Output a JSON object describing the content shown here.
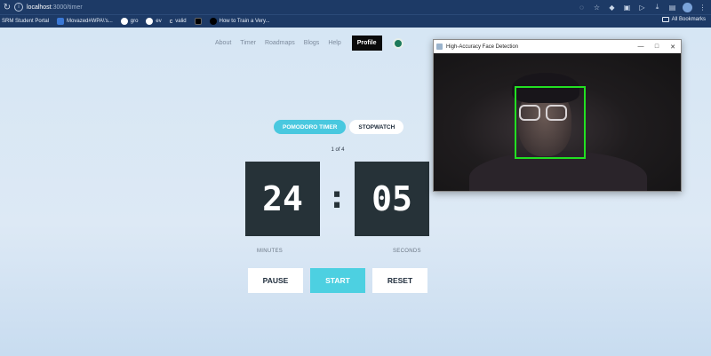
{
  "browser": {
    "url_host": "localhost",
    "url_path": ":3000/timer",
    "bookmarks": [
      {
        "label": "SRM Student Portal",
        "color": "#ffffff"
      },
      {
        "label": "Movazed#WPA\\'s...",
        "color": "#3a78d6"
      },
      {
        "label": "gro",
        "color": "#ffffff"
      },
      {
        "label": "ev",
        "color": "#ffffff"
      },
      {
        "label": "valid",
        "color": "#ffffff"
      },
      {
        "label": "",
        "color": "#000000"
      },
      {
        "label": "How to Train a Very...",
        "color": "#000000"
      }
    ],
    "all_bookmarks": "All Bookmarks"
  },
  "nav": {
    "items": [
      "About",
      "Timer",
      "Roadmaps",
      "Blogs",
      "Help"
    ],
    "profile": "Profile"
  },
  "timer": {
    "tabs": [
      "POMODORO TIMER",
      "STOPWATCH"
    ],
    "session": "1 of 4",
    "minutes": "24",
    "seconds": "05",
    "colon": ":",
    "minutes_label": "MINUTES",
    "seconds_label": "SECONDS",
    "buttons": {
      "pause": "PAUSE",
      "start": "START",
      "reset": "RESET"
    }
  },
  "camera_window": {
    "title": "High-Accuracy Face Detection",
    "detection_color": "#22e022"
  },
  "colors": {
    "accent": "#4dd0e1",
    "clock_bg": "#263238",
    "chrome_bg": "#1d3a66"
  }
}
